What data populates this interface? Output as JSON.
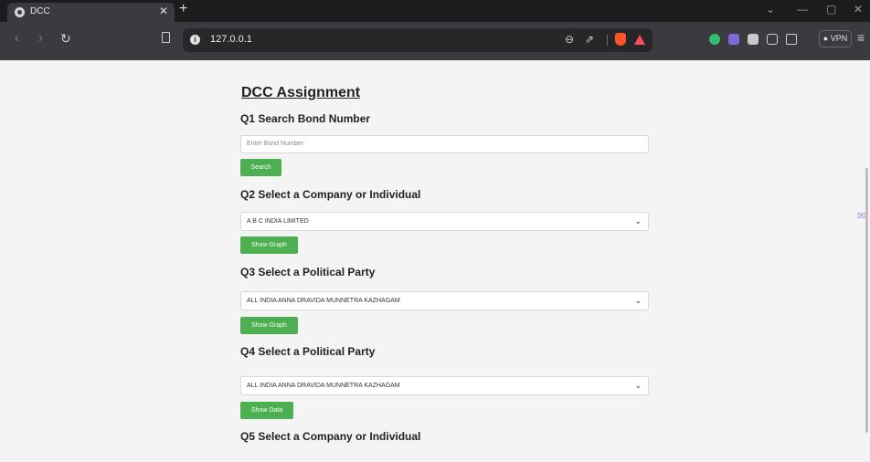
{
  "browser": {
    "tab_title": "DCC",
    "tab_close": "✕",
    "new_tab": "+",
    "url": "127.0.0.1",
    "vpn_label": "● VPN",
    "window_controls": [
      "⌄",
      "—",
      "▢",
      "✕"
    ]
  },
  "page": {
    "heading": "DCC Assignment",
    "q1": {
      "title": "Q1 Search Bond Number",
      "input_placeholder": "Enter Bond Number",
      "button": "Search"
    },
    "q2": {
      "title": "Q2 Select a Company or Individual",
      "selected": "A B C INDIA LIMITED",
      "button": "Show Graph"
    },
    "q3": {
      "title": "Q3 Select a Political Party",
      "selected": "ALL INDIA ANNA DRAVIDA MUNNETRA KAZHAGAM",
      "button": "Show Graph"
    },
    "q4": {
      "title": "Q4 Select a Political Party",
      "selected": "ALL INDIA ANNA DRAVIDA MUNNETRA KAZHAGAM",
      "button": "Show Data"
    },
    "q5": {
      "title": "Q5 Select a Company or Individual"
    }
  },
  "colors": {
    "button_green": "#4caf50",
    "brave_orange": "#fb542b"
  }
}
